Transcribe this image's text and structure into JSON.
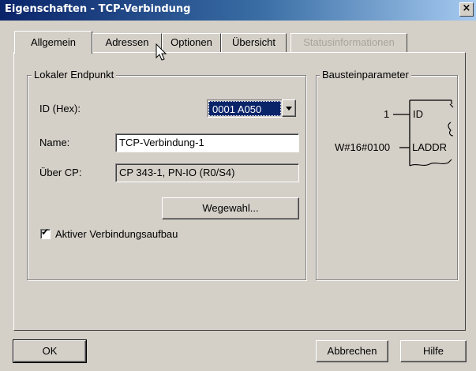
{
  "window": {
    "title": "Eigenschaften - TCP-Verbindung",
    "close_glyph": "×"
  },
  "tabs": [
    {
      "label": "Allgemein",
      "active": true,
      "enabled": true
    },
    {
      "label": "Adressen",
      "active": false,
      "enabled": true
    },
    {
      "label": "Optionen",
      "active": false,
      "enabled": true
    },
    {
      "label": "Übersicht",
      "active": false,
      "enabled": true
    },
    {
      "label": "Statusinformationen",
      "active": false,
      "enabled": false
    }
  ],
  "endpoint": {
    "group_title": "Lokaler Endpunkt",
    "id_label": "ID (Hex):",
    "id_value": "0001 A050",
    "name_label": "Name:",
    "name_value": "TCP-Verbindung-1",
    "cp_label": "Über CP:",
    "cp_value": "CP 343-1, PN-IO (R0/S4)",
    "route_button": "Wegewahl...",
    "active_conn_label": "Aktiver Verbindungsaufbau",
    "active_conn_checked": true,
    "check_glyph": "✔"
  },
  "block": {
    "group_title": "Bausteinparameter",
    "id_input_value": "1",
    "id_pin": "ID",
    "laddr_input_value": "W#16#0100",
    "laddr_pin": "LADDR"
  },
  "footer": {
    "ok_label": "OK",
    "cancel_label": "Abbrechen",
    "help_label": "Hilfe"
  }
}
